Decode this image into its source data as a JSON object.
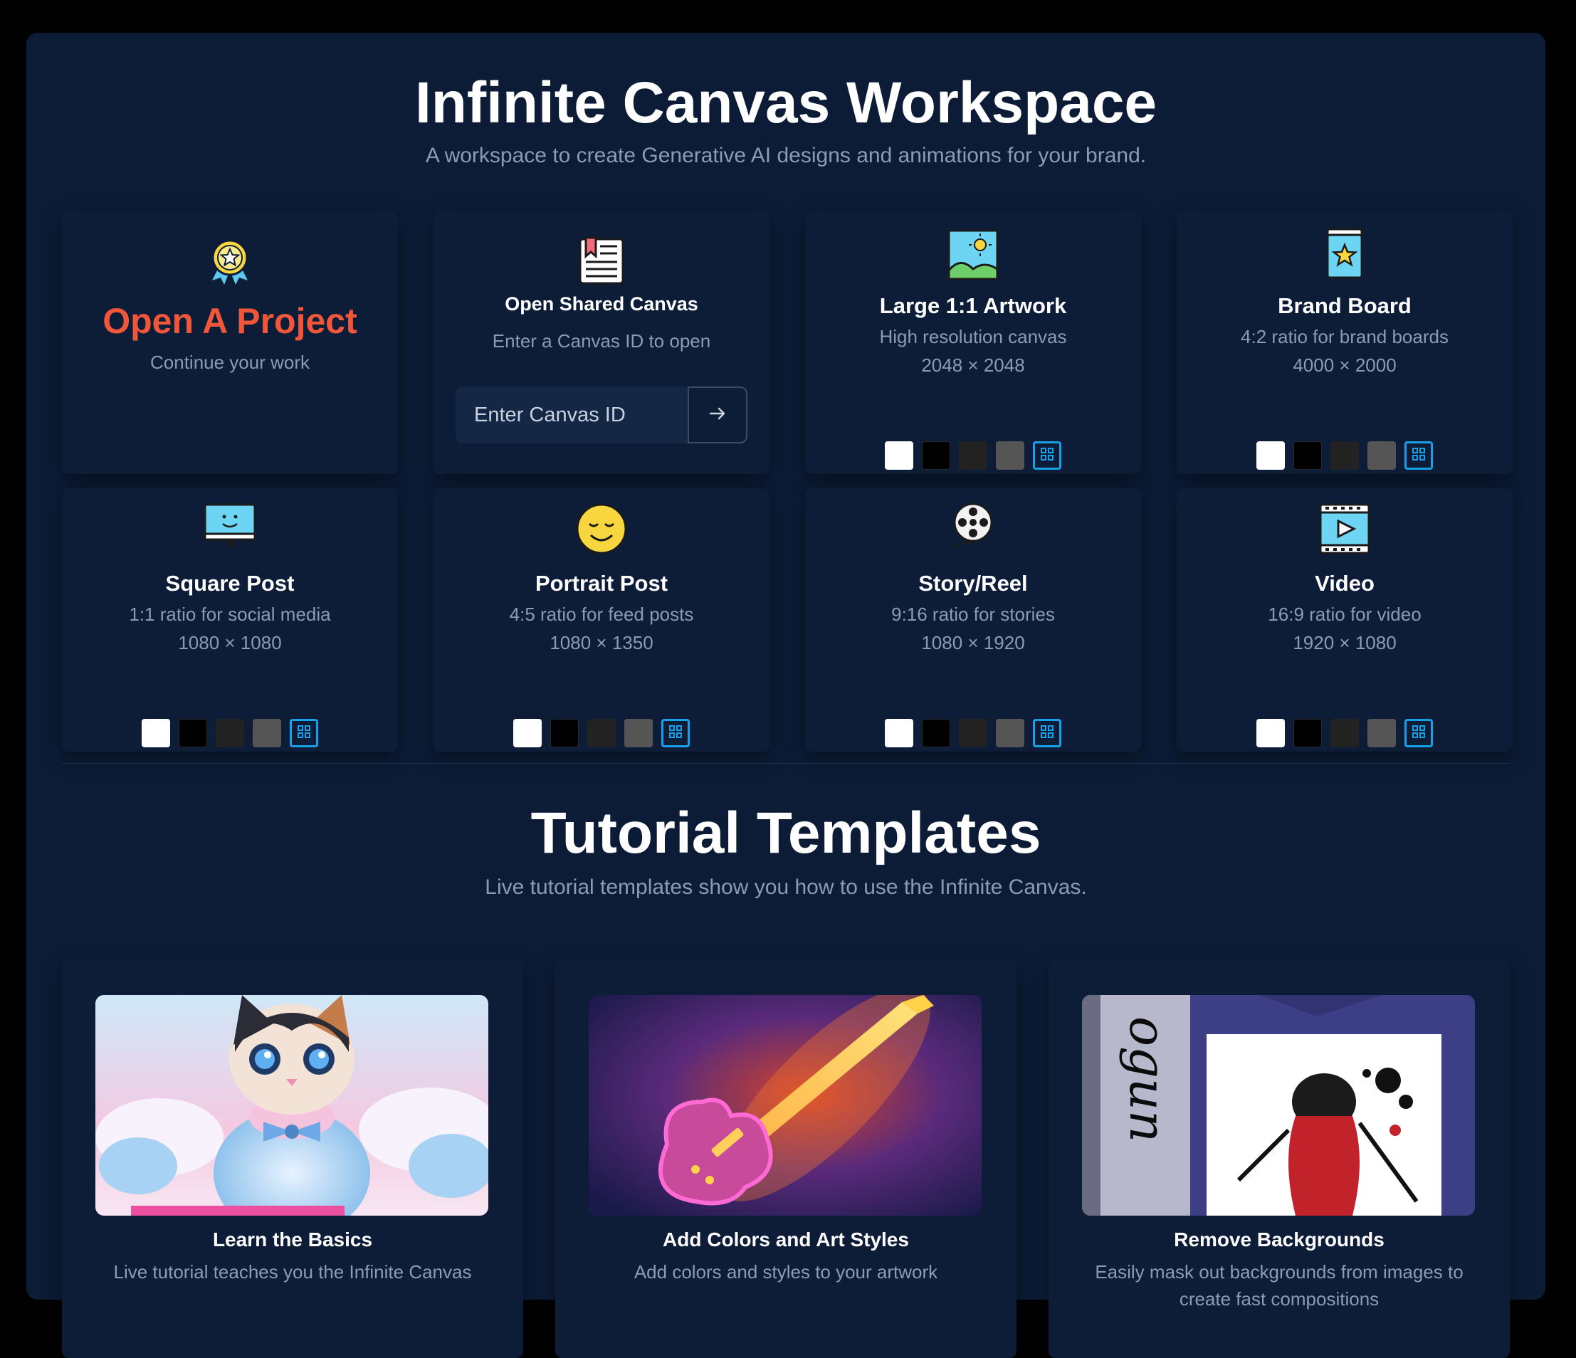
{
  "workspace": {
    "title": "Infinite Canvas Workspace",
    "subtitle": "A workspace to create Generative AI designs and animations for your brand."
  },
  "open_project": {
    "title": "Open A Project",
    "desc": "Continue your work",
    "accent": "#f0573a"
  },
  "shared_canvas": {
    "title": "Open Shared Canvas",
    "desc": "Enter a Canvas ID to open",
    "placeholder": "Enter Canvas ID",
    "button_icon": "arrow-right-icon"
  },
  "swatch_colors": [
    "#ffffff",
    "#000000",
    "#222222",
    "#555555"
  ],
  "accent_blue": "#18a0e8",
  "formats": [
    {
      "title": "Large 1:1 Artwork",
      "desc": "High resolution canvas",
      "size": "2048 × 2048",
      "icon": "landscape-icon"
    },
    {
      "title": "Brand Board",
      "desc": "4:2 ratio for brand boards",
      "size": "4000 × 2000",
      "icon": "star-book-icon"
    },
    {
      "title": "Square Post",
      "desc": "1:1 ratio for social media",
      "size": "1080 × 1080",
      "icon": "monitor-smile-icon"
    },
    {
      "title": "Portrait Post",
      "desc": "4:5 ratio for feed posts",
      "size": "1080 × 1350",
      "icon": "smiley-icon"
    },
    {
      "title": "Story/Reel",
      "desc": "9:16 ratio for stories",
      "size": "1080 × 1920",
      "icon": "film-reel-icon"
    },
    {
      "title": "Video",
      "desc": "16:9 ratio for video",
      "size": "1920 × 1080",
      "icon": "video-play-icon"
    }
  ],
  "tutorials": {
    "title": "Tutorial Templates",
    "subtitle": "Live tutorial templates show you how to use the Infinite Canvas.",
    "items": [
      {
        "title": "Learn the Basics",
        "desc": "Live tutorial teaches you the Infinite Canvas"
      },
      {
        "title": "Add Colors and Art Styles",
        "desc": "Add colors and styles to your artwork"
      },
      {
        "title": "Remove Backgrounds",
        "desc": "Easily mask out backgrounds from images to create fast compositions"
      }
    ]
  }
}
